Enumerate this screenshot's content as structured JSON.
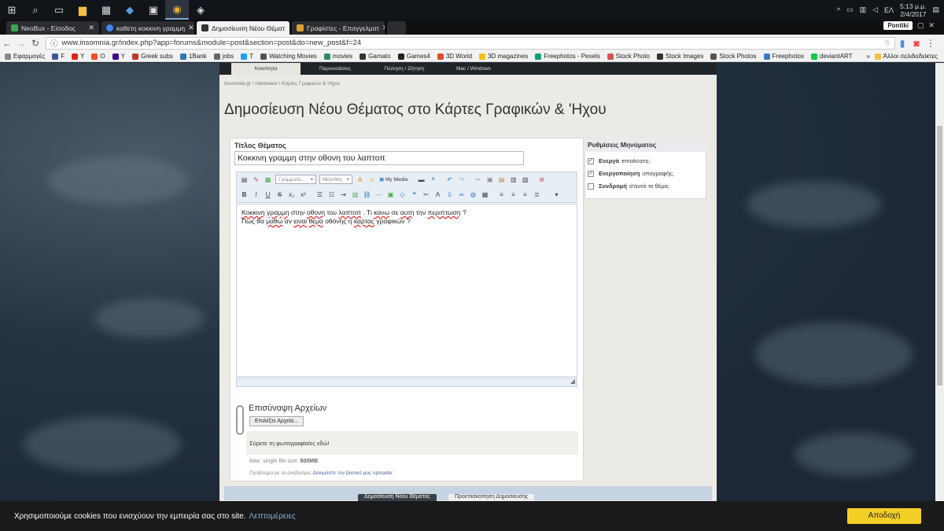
{
  "taskbar": {
    "tray": {
      "lang": "ΕΛ",
      "time": "5:13 μ.μ.",
      "date": "2/4/2017"
    }
  },
  "tabs": [
    {
      "label": "NeoBux - Είσοδος",
      "color": "#3aa655"
    },
    {
      "label": "καθετη κοκκινη γραμμη",
      "color": "#4285f4"
    },
    {
      "label": "Δημοσίευση Νέου Θέματ",
      "color": "#333333"
    },
    {
      "label": "Γραφίστες - Επαγγελματ",
      "color": "#e0a030"
    }
  ],
  "profile": "Pontiki",
  "address": "www.insomnia.gr/index.php?app=forums&module=post&section=post&do=new_post&f=24",
  "bookmarks": [
    {
      "label": "Εφαρμογές",
      "color": "#888888"
    },
    {
      "label": "F",
      "color": "#3b5998"
    },
    {
      "label": "Y",
      "color": "#e62117"
    },
    {
      "label": "O",
      "color": "#f25022"
    },
    {
      "label": "Y",
      "color": "#410093"
    },
    {
      "label": "Greek subs",
      "color": "#c0392b"
    },
    {
      "label": "1Bank",
      "color": "#2a7ab0"
    },
    {
      "label": "jobs",
      "color": "#666666"
    },
    {
      "label": "T",
      "color": "#1da1f2"
    },
    {
      "label": "Watching Movies",
      "color": "#555555"
    },
    {
      "label": "movies",
      "color": "#2e8b57"
    },
    {
      "label": "Gamato",
      "color": "#333333"
    },
    {
      "label": "Games4",
      "color": "#222222"
    },
    {
      "label": "3D World",
      "color": "#e34c26"
    },
    {
      "label": "3D magazines",
      "color": "#f1c40f"
    },
    {
      "label": "Freephotos - Pexels",
      "color": "#05a081"
    },
    {
      "label": "Stock Photo",
      "color": "#d9534f"
    },
    {
      "label": "Stock Images",
      "color": "#333333"
    },
    {
      "label": "Stock Photos",
      "color": "#555555"
    },
    {
      "label": "Freephotos",
      "color": "#3b7bbf"
    },
    {
      "label": "deviantART",
      "color": "#05cc47"
    }
  ],
  "bookmarks_other": "Άλλοι σελιδοδείκτες",
  "nav": [
    "Κοινότητα",
    "Παρουσιάσεις",
    "Πώληση / Ζήτηση",
    "Mac / Windows"
  ],
  "breadcrumb": "Insomnia.gr  \\  Hardware  \\  Κάρτες Γραφικών & 'Ηχου",
  "page_title": "Δημοσίευση Νέου Θέματος στο Κάρτες Γραφικών & 'Ηχου",
  "form": {
    "title_label": "Τίτλος Θέματος",
    "title_value": "Κοκκινη γραμμη στην οθονη του λαπτοπ",
    "font_select": "Γραμματο...",
    "size_select": "Μέγεθος",
    "my_media": "My Media",
    "body_line1": [
      "Κοκκινη",
      " ",
      "γραμμη",
      " στην ",
      "οθονη",
      " του ",
      "λαπτοπ",
      " .  Τι ",
      "κανω",
      " σε ",
      "αυτη",
      " την ",
      "περιπτωση",
      " ?"
    ],
    "body_line2": [
      "Πως  θα ",
      "μαθω",
      " αν ",
      "ειναι",
      " ",
      "θεμα",
      " οθόνης η ",
      "καρτας",
      " γραφικών ?"
    ]
  },
  "attach": {
    "heading": "Επισύναψη Αρχείων",
    "choose": "Επιλέξτε Αρχεία...",
    "drop": "Σύρετε τη φωτογραφία/ες εδώ!",
    "max_label": "Max. single file size:",
    "max_value": "800MB",
    "upload_problem": "Πρόβλημα με το ανέβασμα;",
    "upload_link": "Δοκιμάστε τον βασικό μας uploader"
  },
  "sidebar": {
    "heading": "Ρυθμίσεις Μηνύματος",
    "options": [
      {
        "bold": "Ενεργά",
        "rest": "emoticons;",
        "checked": true
      },
      {
        "bold": "Ενεργοποίηση",
        "rest": "υπογραφής;",
        "checked": true
      },
      {
        "bold": "Συνδρομή",
        "rest": "σ'αυτό το θέμα;",
        "checked": false
      }
    ]
  },
  "buttons": {
    "post": "Δημοσίευση Νέου Θέματος",
    "preview": "Προεπισκόπηση Δημοσίευσης"
  },
  "cookie": {
    "message": "Χρησιμοποιούμε cookies που ενισχύουν την εμπειρία σας στο site.",
    "more": "Λεπτομέρειες",
    "accept": "Αποδοχή"
  }
}
